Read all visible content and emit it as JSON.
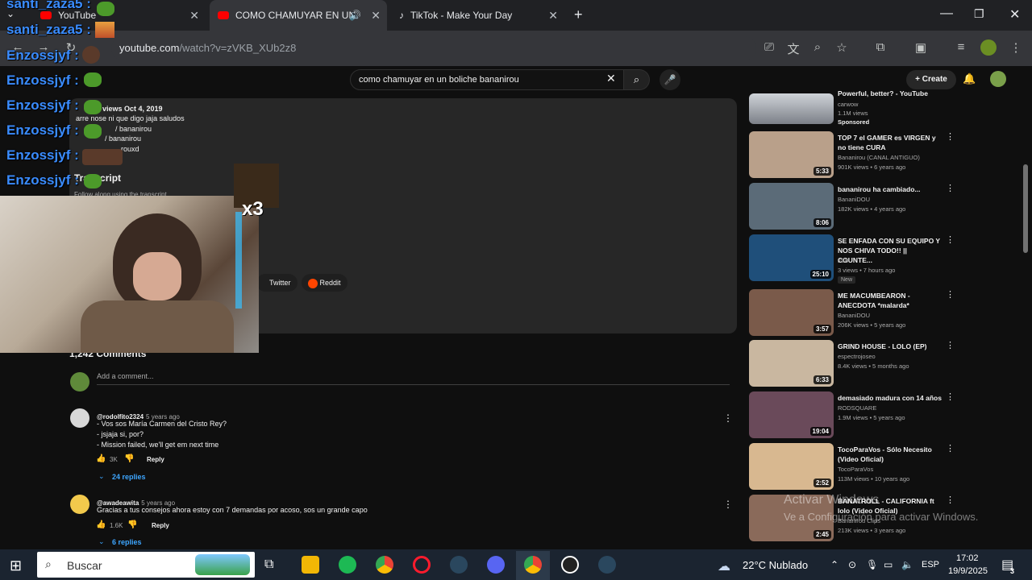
{
  "browser": {
    "tabs": [
      {
        "label": "YouTube"
      },
      {
        "label": "COMO CHAMUYAR EN UN"
      },
      {
        "label": "TikTok - Make Your Day"
      }
    ],
    "url_host": "youtube.com",
    "url_path": "/watch?v=zVKB_XUb2z8"
  },
  "masthead": {
    "search_value": "como chamuyar en un boliche bananirou",
    "create_label": "Create"
  },
  "description": {
    "meta": "views  Oct 4, 2019",
    "line1": "arre nose ni que digo jaja saludos",
    "line2": "/ bananirou",
    "line3": "/ bananirou",
    "line4": "rouxd",
    "transcript_heading": "Transcript",
    "transcript_sub": "Follow along using the transcript.",
    "share_twitter": "Twitter",
    "share_reddit": "Reddit"
  },
  "comments": {
    "count_label": "1,242 Comments",
    "add_placeholder": "Add a comment...",
    "items": [
      {
        "author": "@rodolfito2324",
        "time": "5 years ago",
        "lines": [
          "- Vos sos María Carmen del Cristo Rey?",
          "- jsjaja si, por?",
          "- Mission failed, we'll get em next time"
        ],
        "likes": "3K",
        "reply": "Reply",
        "replies": "24 replies"
      },
      {
        "author": "@awadeawita",
        "time": "5 years ago",
        "lines": [
          "Gracias a tus consejos ahora estoy con 7 demandas por acoso, sos un grande capo"
        ],
        "likes": "1.6K",
        "reply": "Reply",
        "replies": "6 replies"
      }
    ]
  },
  "recommendations": [
    {
      "title": "Powerful, better? - YouTube",
      "channel": "carwow",
      "meta": "1.1M views",
      "badge": "Sponsored",
      "duration": "",
      "color": "#8a8f96"
    },
    {
      "title": "TOP 7 el GAMER es VIRGEN y no tiene CURA",
      "channel": "Bananirou (CANAL ANTIGUO)",
      "meta": "901K views • 6 years ago",
      "badge": "",
      "duration": "5:33",
      "color": "#b9a08a"
    },
    {
      "title": "bananirou ha cambiado...",
      "channel": "BananiDOU",
      "meta": "182K views • 4 years ago",
      "badge": "",
      "duration": "8:06",
      "color": "#5b6b78"
    },
    {
      "title": "SE ENFADA CON SU EQUIPO Y NOS CHIVA TODO!! || COUNTE...",
      "channel": "JS8",
      "meta": "3 views • 7 hours ago",
      "badge": "New",
      "duration": "25:10",
      "color": "#1f4f7a"
    },
    {
      "title": "ME MACUMBEARON - ANECDOTA *malarda*",
      "channel": "BananiDOU",
      "meta": "206K views • 5 years ago",
      "badge": "",
      "duration": "3:57",
      "color": "#7a5a4a"
    },
    {
      "title": "GRIND HOUSE - LOLO (EP)",
      "channel": "espectrojoseo",
      "meta": "8.4K views • 5 months ago",
      "badge": "",
      "duration": "6:33",
      "color": "#c9b7a0"
    },
    {
      "title": "demasiado madura con 14 años",
      "channel": "RODSQUARE",
      "meta": "1.9M views • 5 years ago",
      "badge": "",
      "duration": "19:04",
      "color": "#6a4a5a"
    },
    {
      "title": "TocoParaVos - Sólo Necesito (Video Oficial)",
      "channel": "TocoParaVos",
      "meta": "113M views • 10 years ago",
      "badge": "",
      "duration": "2:52",
      "color": "#d8b890"
    },
    {
      "title": "BANATROLL - CALIFORNIA ft lolo (Video Oficial)",
      "channel": "Bananirou Clips",
      "meta": "213K views • 3 years ago",
      "badge": "",
      "duration": "2:45",
      "color": "#8a6a5a"
    }
  ],
  "chat_overlay": [
    {
      "user": "santi_zaza5 :"
    },
    {
      "user": "santi_zaza5 :"
    },
    {
      "user": "Enzossjyf :"
    },
    {
      "user": "Enzossjyf :"
    },
    {
      "user": "Enzossjyf :"
    },
    {
      "user": "Enzossjyf :"
    },
    {
      "user": "Enzossjyf :"
    },
    {
      "user": "Enzossjyf :"
    }
  ],
  "overlay_multiplier": "x3",
  "watermark": {
    "line1": "Activar Windows",
    "line2": "Ve a Configuración para activar Windows."
  },
  "taskbar": {
    "search_label": "Buscar",
    "weather": "22°C  Nublado",
    "lang": "ESP",
    "time": "17:02",
    "date": "19/9/2025",
    "notif_count": "3"
  }
}
